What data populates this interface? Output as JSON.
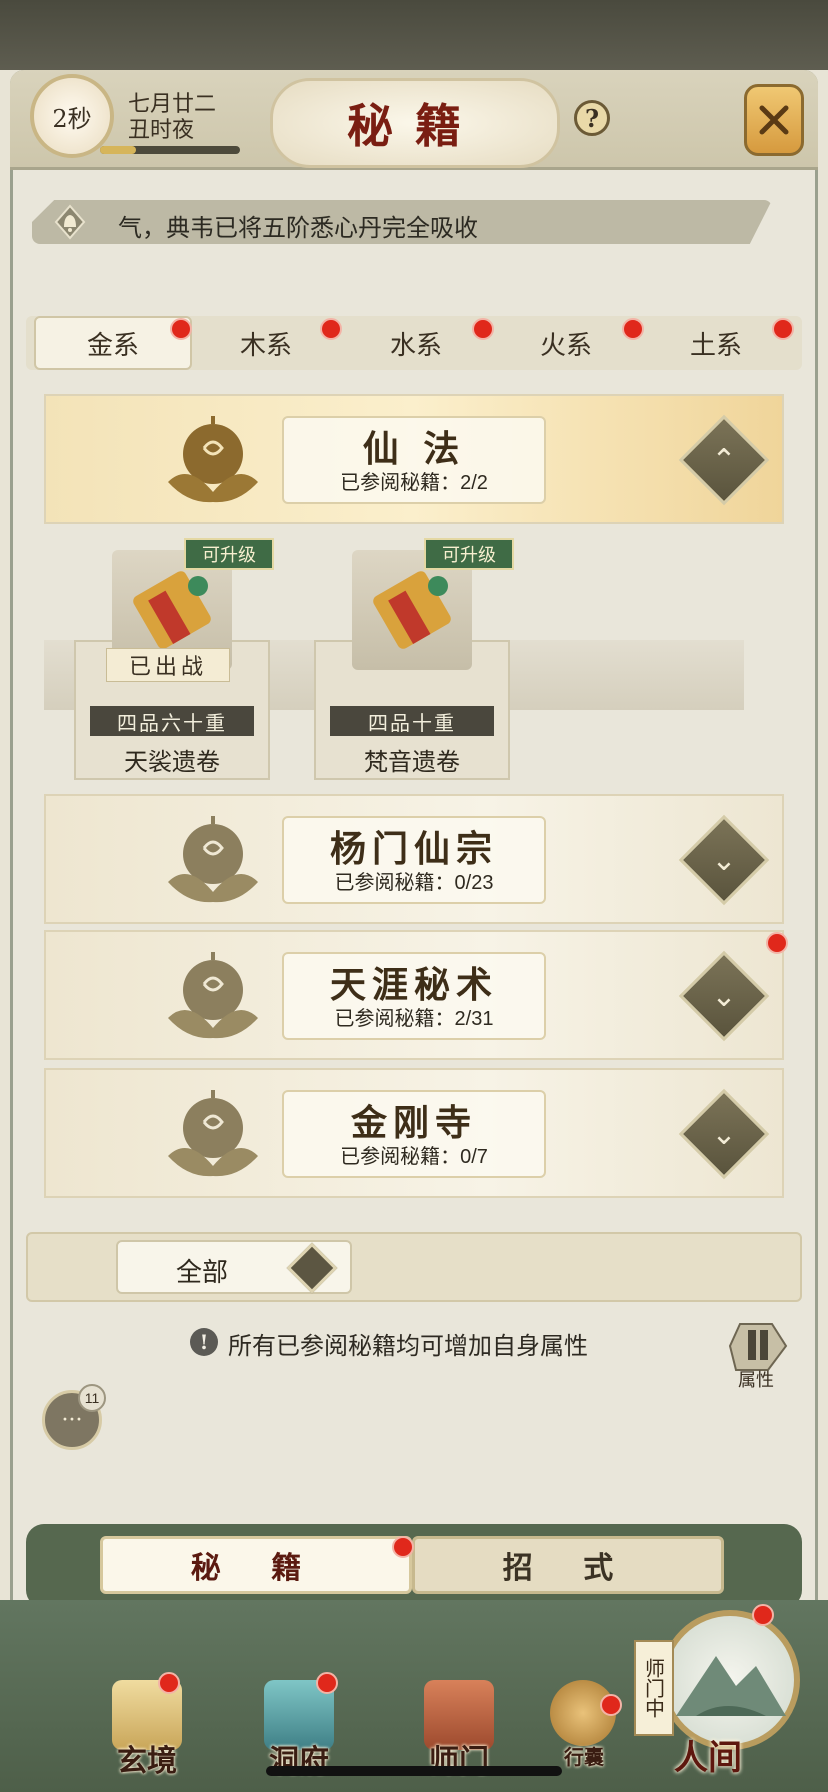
{
  "header": {
    "timer": "2秒",
    "date_line1": "七月廿二",
    "date_line2": "丑时夜",
    "title": "秘籍",
    "help_icon": "?"
  },
  "notice": {
    "text": "气，典韦已将五阶悉心丹完全吸收"
  },
  "element_tabs": [
    {
      "label": "金系",
      "active": true,
      "red_dot": true
    },
    {
      "label": "木系",
      "active": false,
      "red_dot": true
    },
    {
      "label": "水系",
      "active": false,
      "red_dot": true
    },
    {
      "label": "火系",
      "active": false,
      "red_dot": true
    },
    {
      "label": "土系",
      "active": false,
      "red_dot": true
    }
  ],
  "sections": [
    {
      "name": "仙 法",
      "progress": "已参阅秘籍：2/2",
      "expanded": true,
      "toggle_icon": "chevron-up-icon"
    },
    {
      "name": "杨门仙宗",
      "progress": "已参阅秘籍：0/23",
      "expanded": false,
      "toggle_icon": "chevron-down-icon"
    },
    {
      "name": "天涯秘术",
      "progress": "已参阅秘籍：2/31",
      "expanded": false,
      "toggle_icon": "chevron-down-icon",
      "red_dot": true
    },
    {
      "name": "金刚寺",
      "progress": "已参阅秘籍：0/7",
      "expanded": false,
      "toggle_icon": "chevron-down-icon"
    }
  ],
  "books": [
    {
      "badge": "可升级",
      "status": "已出战",
      "grade": "四品六十重",
      "name": "天裟遗卷"
    },
    {
      "badge": "可升级",
      "status": "",
      "grade": "四品十重",
      "name": "梵音遗卷"
    }
  ],
  "filter": {
    "label": "全部"
  },
  "hint": {
    "text": "所有已参阅秘籍均可增加自身属性",
    "icon": "!"
  },
  "attr_button": {
    "label": "属性"
  },
  "chat": {
    "badge_count": "11"
  },
  "mode_tabs": [
    {
      "label": "秘 籍",
      "active": true,
      "red_dot": true
    },
    {
      "label": "招 式",
      "active": false
    }
  ],
  "nav": [
    {
      "label": "玄境",
      "red_dot": true
    },
    {
      "label": "洞府",
      "red_dot": true
    },
    {
      "label": "师门",
      "red_dot": false
    },
    {
      "label": "行囊",
      "red_dot": true
    }
  ],
  "world": {
    "tag": "师门中",
    "label": "人间",
    "red_dot": true
  },
  "colors": {
    "accent_red": "#e0281b",
    "title_red": "#7a1e12",
    "nav_green": "#56684f"
  }
}
